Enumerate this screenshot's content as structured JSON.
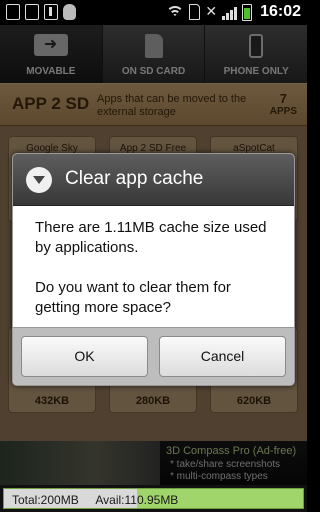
{
  "status_bar": {
    "time": "16:02",
    "icons": [
      "notification-icon",
      "usb-icon",
      "debug-bug-icon",
      "wifi-icon",
      "sd-card-icon",
      "signal-icon",
      "battery-icon"
    ]
  },
  "tabs": [
    {
      "label": "MOVABLE",
      "icon": "movable-icon",
      "active": true
    },
    {
      "label": "ON SD CARD",
      "icon": "sd-card-icon",
      "active": false
    },
    {
      "label": "PHONE ONLY",
      "icon": "phone-icon",
      "active": false
    }
  ],
  "header": {
    "title": "APP 2 SD",
    "description": "Apps that can be moved to the external storage",
    "count": "7",
    "count_unit": "APPS"
  },
  "apps": [
    {
      "name": "Google Sky",
      "size": ""
    },
    {
      "name": "App 2 SD Free",
      "size": ""
    },
    {
      "name": "aSpotCat",
      "size": ""
    },
    {
      "name": "",
      "size": "432KB"
    },
    {
      "name": "",
      "size": "280KB"
    },
    {
      "name": "",
      "size": "620KB"
    }
  ],
  "ad": {
    "title": "3D Compass Pro (Ad-free)",
    "lines": [
      "* take/share screenshots",
      "* multi-compass types"
    ]
  },
  "storage": {
    "total": "Total:200MB",
    "avail": "Avail:110.95MB",
    "used_fraction": 0.445
  },
  "dialog": {
    "title": "Clear app cache",
    "message_1": "There are 1.11MB cache size used by applications.",
    "message_2": "Do you want to clear them for getting more space?",
    "ok_label": "OK",
    "cancel_label": "Cancel"
  }
}
